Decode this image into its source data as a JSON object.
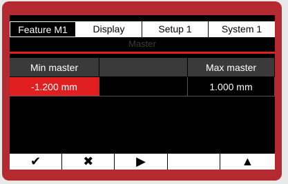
{
  "tabs": [
    {
      "label": "Feature  M1",
      "active": true
    },
    {
      "label": "Display",
      "active": false
    },
    {
      "label": "Setup 1",
      "active": false
    },
    {
      "label": "System 1",
      "active": false
    }
  ],
  "subtitle": "Master",
  "table": {
    "headers": [
      "Min master",
      "",
      "Max master"
    ],
    "values": [
      "-1.200 mm",
      "",
      "1.000 mm"
    ]
  },
  "softkeys": [
    {
      "name": "confirm",
      "icon": "check-icon",
      "glyph": "✔"
    },
    {
      "name": "cancel",
      "icon": "close-icon",
      "glyph": "✖"
    },
    {
      "name": "play",
      "icon": "play-icon",
      "glyph": "▶"
    },
    {
      "name": "empty",
      "icon": "",
      "glyph": ""
    },
    {
      "name": "up",
      "icon": "arrow-up-icon",
      "glyph": "▲"
    }
  ],
  "colors": {
    "accent": "#e02020",
    "bezel": "#b42a30"
  }
}
